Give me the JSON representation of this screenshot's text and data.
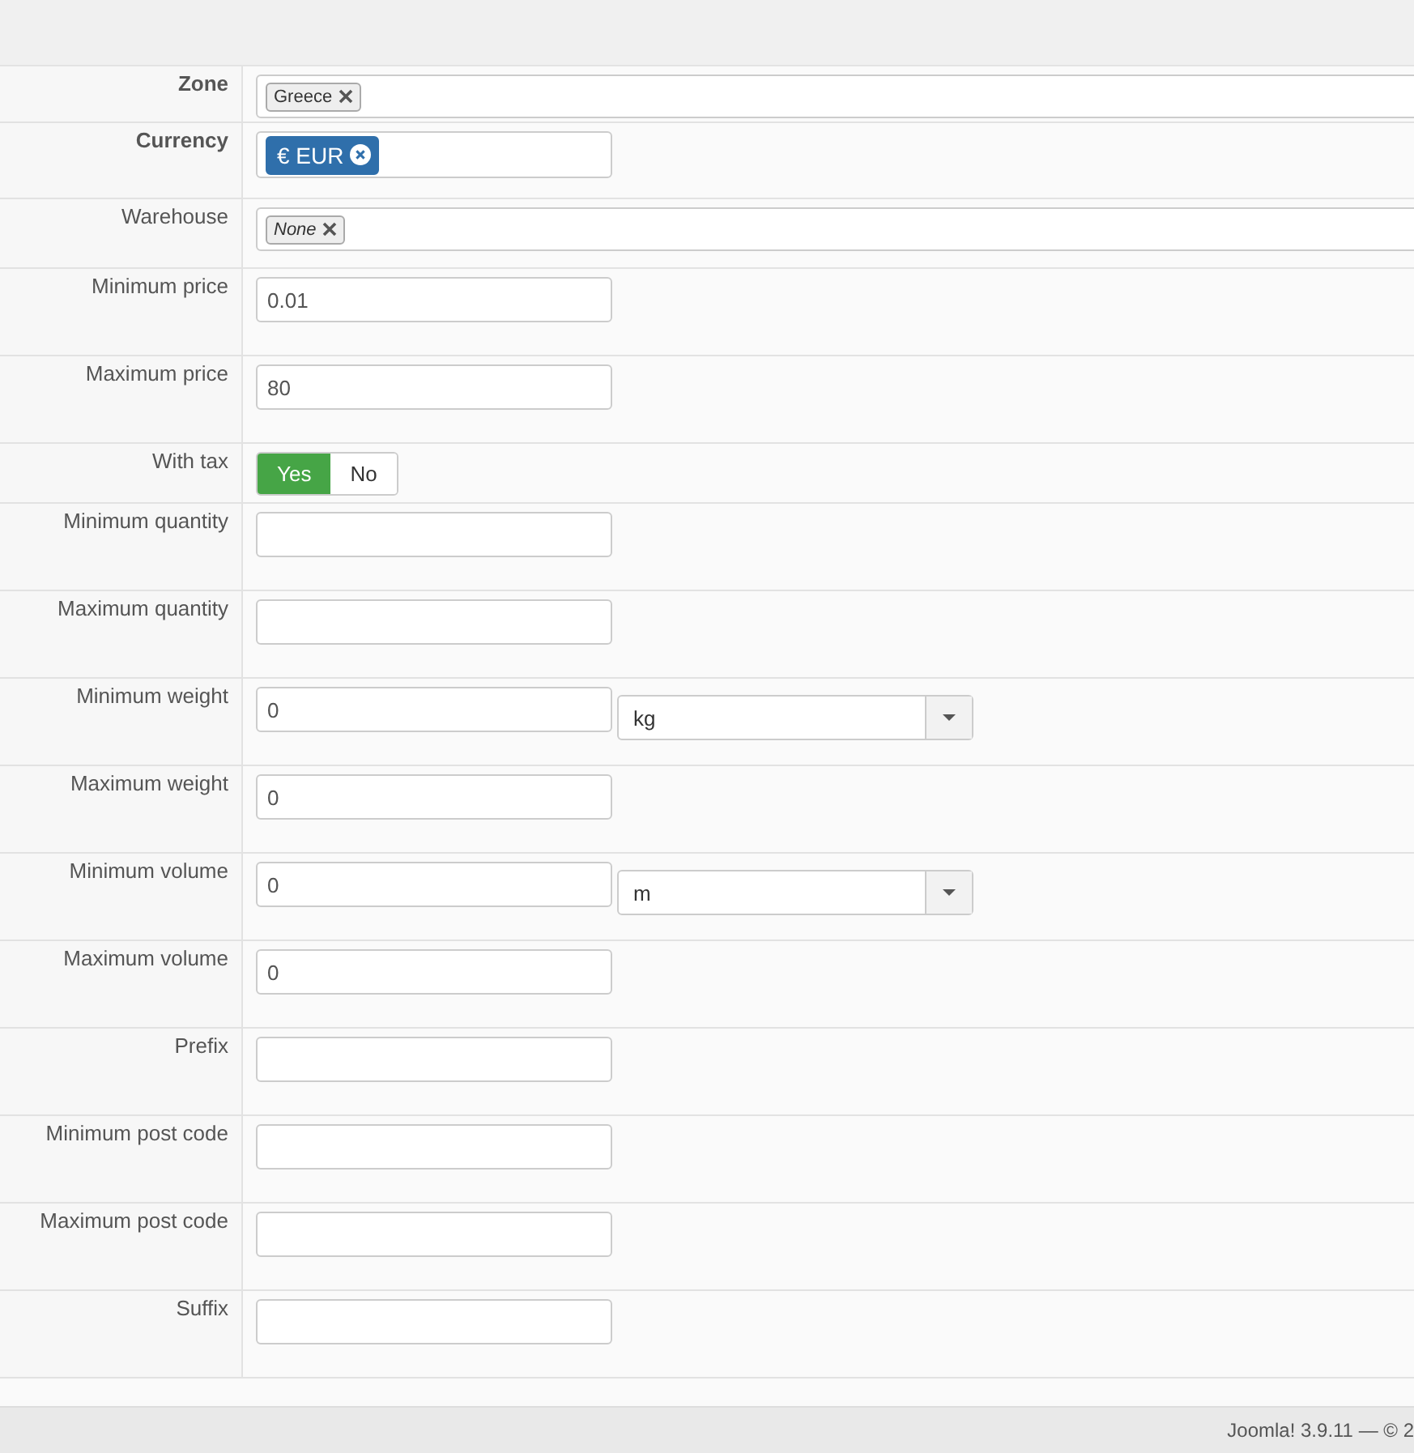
{
  "rows": [
    {
      "label": "Zone",
      "required": true,
      "kind": "tags",
      "tags": [
        {
          "text": "Greece",
          "primary": false,
          "italic": false
        }
      ]
    },
    {
      "label": "Currency",
      "required": true,
      "kind": "tags-short",
      "tags": [
        {
          "text": "€ EUR",
          "primary": true,
          "italic": false
        }
      ]
    },
    {
      "label": "Warehouse",
      "required": false,
      "kind": "tags",
      "tags": [
        {
          "text": "None",
          "primary": false,
          "italic": true
        }
      ]
    },
    {
      "label": "Minimum price",
      "required": false,
      "kind": "input",
      "value": "0.01"
    },
    {
      "label": "Maximum price",
      "required": false,
      "kind": "input",
      "value": "80"
    },
    {
      "label": "With tax",
      "required": false,
      "kind": "toggle",
      "options": [
        {
          "text": "Yes",
          "selected": true
        },
        {
          "text": "No",
          "selected": false
        }
      ]
    },
    {
      "label": "Minimum quantity",
      "required": false,
      "kind": "input"
    },
    {
      "label": "Maximum quantity",
      "required": false,
      "kind": "input"
    },
    {
      "label": "Minimum weight",
      "required": false,
      "kind": "input-select",
      "value": "0",
      "unit": "kg"
    },
    {
      "label": "Maximum weight",
      "required": false,
      "kind": "input",
      "value": "0"
    },
    {
      "label": "Minimum volume",
      "required": false,
      "kind": "input-select",
      "value": "0",
      "unit": "m"
    },
    {
      "label": "Maximum volume",
      "required": false,
      "kind": "input",
      "value": "0"
    },
    {
      "label": "Prefix",
      "required": false,
      "kind": "input"
    },
    {
      "label": "Minimum post code",
      "required": false,
      "kind": "input"
    },
    {
      "label": "Maximum post code",
      "required": false,
      "kind": "input"
    },
    {
      "label": "Suffix",
      "required": false,
      "kind": "input"
    }
  ],
  "footer": "Joomla! 3.9.11 — © 2"
}
